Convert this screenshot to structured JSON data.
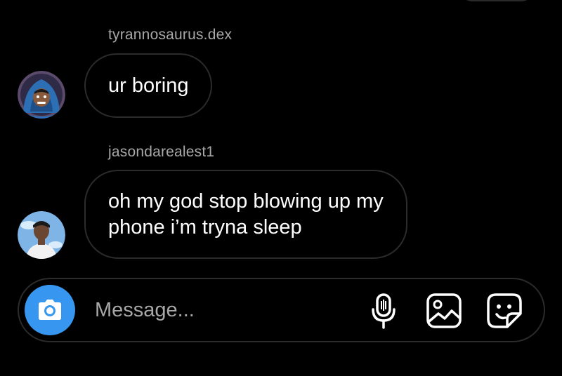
{
  "thread": {
    "messages": [
      {
        "sender": "tyrannosaurus.dex",
        "text": "ur boring",
        "avatar_icon": "hooded-cartoon-avatar-icon"
      },
      {
        "sender": "jasondarealest1",
        "text_lines": [
          "oh my god stop blowing up my",
          "phone i’m tryna sleep"
        ],
        "avatar_icon": "cartoon-man-sky-avatar-icon"
      }
    ]
  },
  "composer": {
    "placeholder": "Message...",
    "camera_icon": "camera-icon",
    "mic_icon": "microphone-icon",
    "gallery_icon": "gallery-icon",
    "sticker_icon": "sticker-icon"
  },
  "colors": {
    "background": "#000000",
    "bubble_border": "#2b2b2b",
    "sender_text": "#a8a8a8",
    "accent_blue": "#3797f0"
  }
}
